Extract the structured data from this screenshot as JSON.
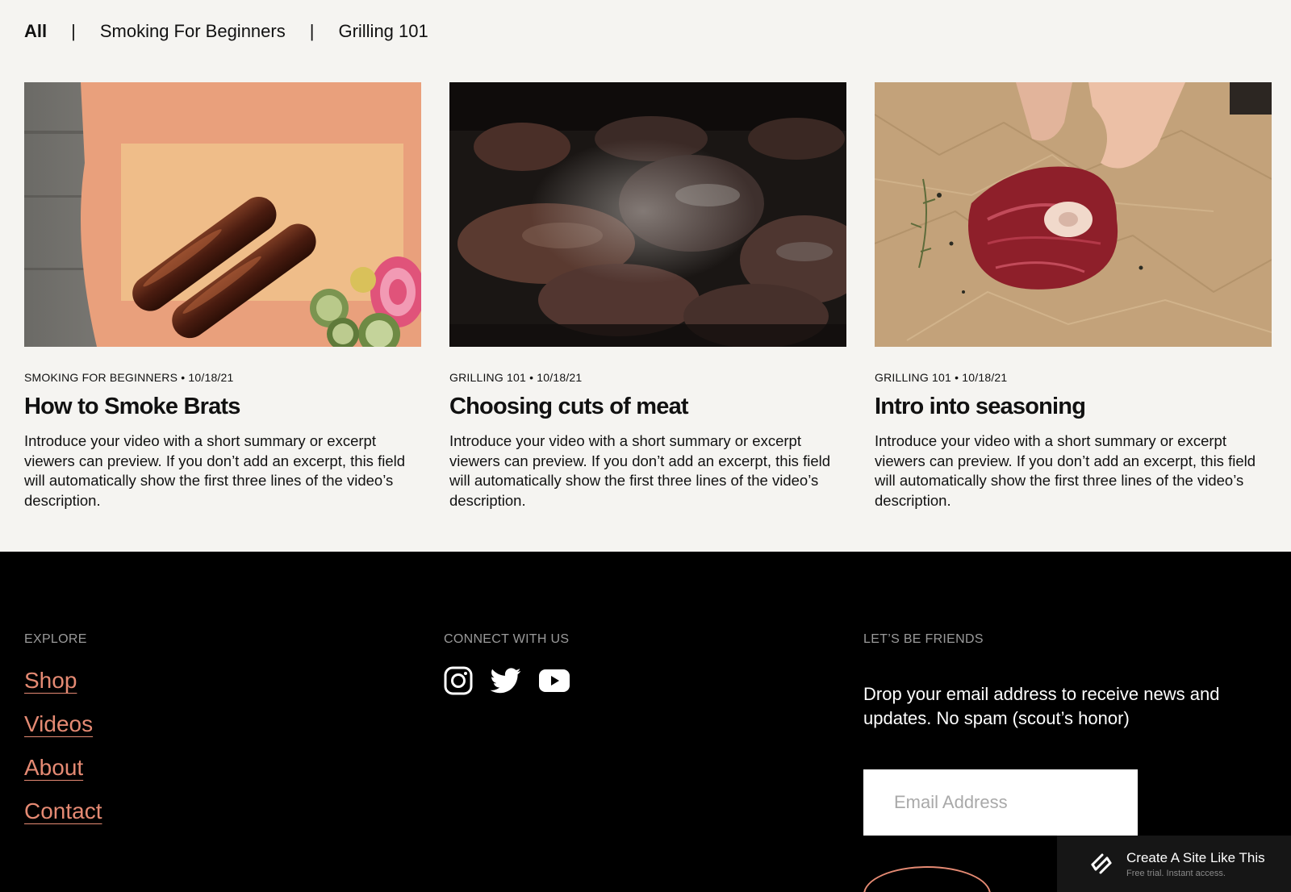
{
  "filters": {
    "all": "All",
    "smoking": "Smoking For Beginners",
    "grilling": "Grilling 101",
    "separator": "|"
  },
  "videos": [
    {
      "meta": "SMOKING FOR BEGINNERS • 10/18/21",
      "title": "How to Smoke Brats",
      "excerpt": "Introduce your video with a short summary or excerpt viewers can preview. If you don’t add an excerpt, this field will automatically show the first three lines of the video’s description."
    },
    {
      "meta": "GRILLING 101 • 10/18/21",
      "title": "Choosing cuts of meat",
      "excerpt": "Introduce your video with a short summary or excerpt viewers can preview. If you don’t add an excerpt, this field will automatically show the first three lines of the video’s description."
    },
    {
      "meta": "GRILLING 101 • 10/18/21",
      "title": "Intro into seasoning",
      "excerpt": "Introduce your video with a short summary or excerpt viewers can preview. If you don’t add an excerpt, this field will automatically show the first three lines of the video’s description."
    }
  ],
  "footer": {
    "explore_title": "EXPLORE",
    "links": [
      "Shop",
      "Videos",
      "About",
      "Contact"
    ],
    "connect_title": "CONNECT WITH US",
    "social_icons": [
      "instagram-icon",
      "twitter-icon",
      "youtube-icon"
    ],
    "friends_title": "LET’S BE FRIENDS",
    "friends_text": "Drop your email address to receive news and updates. No spam (scout’s honor)",
    "email_placeholder": "Email Address"
  },
  "badge": {
    "title": "Create A Site Like This",
    "subtitle": "Free trial. Instant access."
  },
  "colors": {
    "background": "#f5f4f1",
    "footer_bg": "#000000",
    "accent": "#e58a73"
  }
}
